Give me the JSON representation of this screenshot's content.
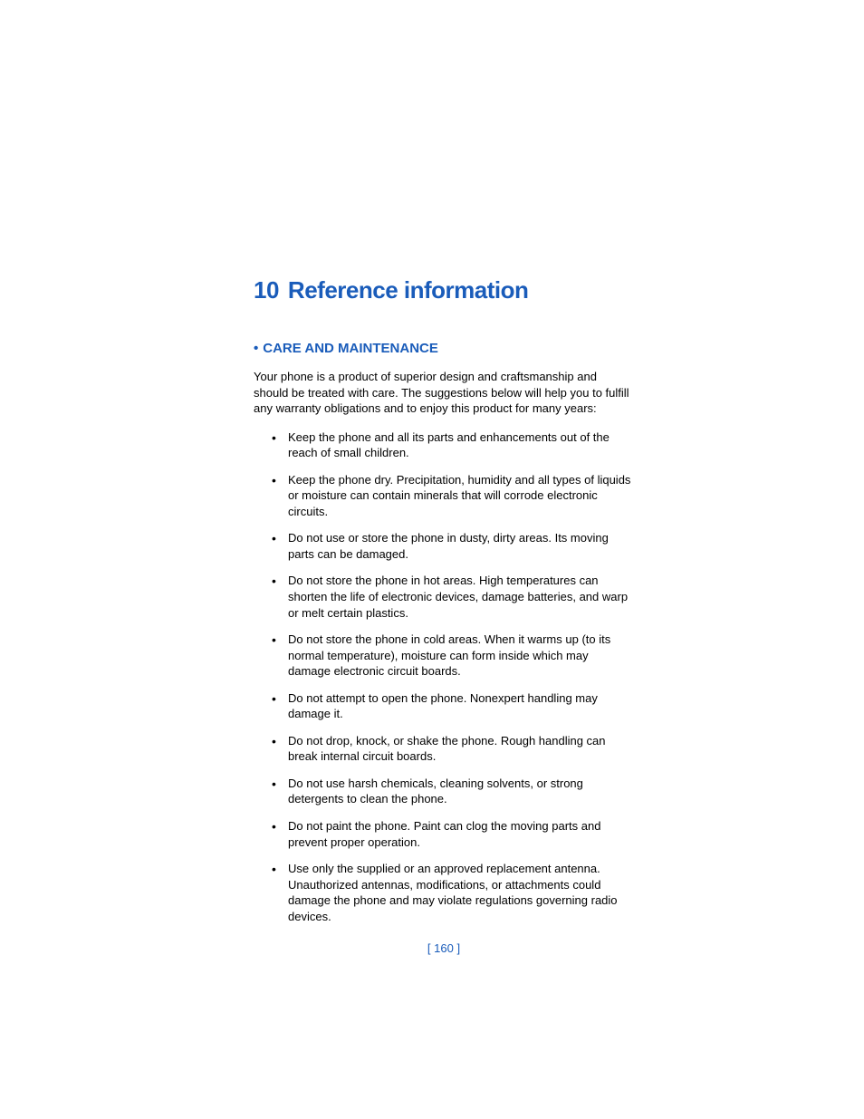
{
  "chapter": {
    "number": "10",
    "title": "Reference information"
  },
  "section": {
    "heading": "CARE AND MAINTENANCE",
    "intro": "Your phone is a product of superior design and craftsmanship and should be treated with care. The suggestions below will help you to fulfill any warranty obligations and to enjoy this product for many years:",
    "bullets": [
      "Keep the phone and all its parts and enhancements out of the reach of small children.",
      "Keep the phone dry. Precipitation, humidity and all types of liquids or moisture can contain minerals that will corrode electronic circuits.",
      "Do not use or store the phone in dusty, dirty areas. Its moving parts can be damaged.",
      "Do not store the phone in hot areas. High temperatures can shorten the life of electronic devices, damage batteries, and warp or melt certain plastics.",
      "Do not store the phone in cold areas. When it warms up (to its normal temperature), moisture can form inside which may damage electronic circuit boards.",
      "Do not attempt to open the phone. Nonexpert handling may damage it.",
      "Do not drop, knock, or shake the phone. Rough handling can break internal circuit boards.",
      "Do not use harsh chemicals, cleaning solvents, or strong detergents to clean the phone.",
      "Do not paint the phone. Paint can clog the moving parts and prevent proper operation.",
      "Use only the supplied or an approved replacement antenna. Unauthorized antennas, modifications, or attachments could damage the phone and may violate regulations governing radio devices."
    ]
  },
  "page_number": "[ 160 ]"
}
